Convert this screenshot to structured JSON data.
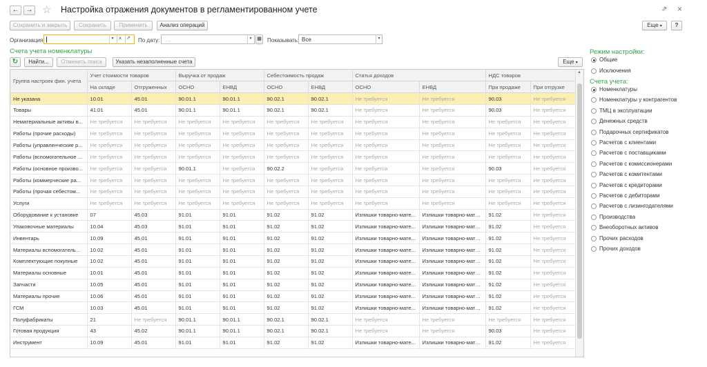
{
  "window": {
    "title": "Настройка отражения документов в регламентированном учете",
    "back_glyph": "←",
    "forward_glyph": "→",
    "star_glyph": "☆",
    "link_glyph": "⇗",
    "close_glyph": "×"
  },
  "toolbar": {
    "save_close": "Сохранить и закрыть",
    "save": "Сохранить",
    "apply": "Применить",
    "analysis": "Анализ операций",
    "more": "Еще",
    "help": "?"
  },
  "filters": {
    "org_label": "Организация:",
    "org_value": "",
    "date_label": "По дату:",
    "date_value": ". .",
    "show_label": "Показывать:",
    "show_value": "Все"
  },
  "section": {
    "title": "Счета учета номенклатуры",
    "find": "Найти...",
    "cancel_search": "Отменить поиск",
    "show_unfilled": "Указать незаполненные счета",
    "more": "Еще"
  },
  "table": {
    "group_header": "Группа настроек фин. учета",
    "group_headers": [
      "Учет стоимости товаров",
      "Выручка от продаж",
      "Себестоимость продаж",
      "Статья доходов",
      "НДС товаров"
    ],
    "sub_headers": [
      "На складе",
      "Отгруженных",
      "ОСНО",
      "ЕНВД",
      "ОСНО",
      "ЕНВД",
      "ОСНО",
      "ЕНВД",
      "При продаже",
      "При отгрузке"
    ],
    "rows": [
      [
        "Не указана",
        "10.01",
        "45.01",
        "90.01.1",
        "90.01.1",
        "90.02.1",
        "90.02.1",
        "Не требуется",
        "Не требуется",
        "90.03",
        "Не требуется"
      ],
      [
        "Товары",
        "41.01",
        "45.01",
        "90.01.1",
        "90.01.1",
        "90.02.1",
        "90.02.1",
        "Не требуется",
        "Не требуется",
        "90.03",
        "Не требуется"
      ],
      [
        "Нематериальные активы в...",
        "Не требуется",
        "Не требуется",
        "Не требуется",
        "Не требуется",
        "Не требуется",
        "Не требуется",
        "Не требуется",
        "Не требуется",
        "Не требуется",
        "Не требуется"
      ],
      [
        "Работы (прочие расходы)",
        "Не требуется",
        "Не требуется",
        "Не требуется",
        "Не требуется",
        "Не требуется",
        "Не требуется",
        "Не требуется",
        "Не требуется",
        "Не требуется",
        "Не требуется"
      ],
      [
        "Работы (управленческие р...",
        "Не требуется",
        "Не требуется",
        "Не требуется",
        "Не требуется",
        "Не требуется",
        "Не требуется",
        "Не требуется",
        "Не требуется",
        "Не требуется",
        "Не требуется"
      ],
      [
        "Работы (вспомогательное ...",
        "Не требуется",
        "Не требуется",
        "Не требуется",
        "Не требуется",
        "Не требуется",
        "Не требуется",
        "Не требуется",
        "Не требуется",
        "Не требуется",
        "Не требуется"
      ],
      [
        "Работы (основное произво...",
        "Не требуется",
        "Не требуется",
        "90.01.1",
        "Не требуется",
        "90.02.2",
        "Не требуется",
        "Не требуется",
        "Не требуется",
        "90.03",
        "Не требуется"
      ],
      [
        "Работы (коммерческие ра...",
        "Не требуется",
        "Не требуется",
        "Не требуется",
        "Не требуется",
        "Не требуется",
        "Не требуется",
        "Не требуется",
        "Не требуется",
        "Не требуется",
        "Не требуется"
      ],
      [
        "Работы (прочая себестом...",
        "Не требуется",
        "Не требуется",
        "Не требуется",
        "Не требуется",
        "Не требуется",
        "Не требуется",
        "Не требуется",
        "Не требуется",
        "Не требуется",
        "Не требуется"
      ],
      [
        "Услуги",
        "Не требуется",
        "Не требуется",
        "Не требуется",
        "Не требуется",
        "Не требуется",
        "Не требуется",
        "Не требуется",
        "Не требуется",
        "Не требуется",
        "Не требуется"
      ],
      [
        "Оборудование к установке",
        "07",
        "45.03",
        "91.01",
        "91.01",
        "91.02",
        "91.02",
        "Излишки товарно-мате...",
        "Излишки товарно-мате...",
        "91.02",
        "Не требуется"
      ],
      [
        "Упаковочные материалы",
        "10.04",
        "45.03",
        "91.01",
        "91.01",
        "91.02",
        "91.02",
        "Излишки товарно-мате...",
        "Излишки товарно-мате...",
        "91.02",
        "Не требуется"
      ],
      [
        "Инвентарь",
        "10.09",
        "45.01",
        "91.01",
        "91.01",
        "91.02",
        "91.02",
        "Излишки товарно-мате...",
        "Излишки товарно-мате...",
        "91.02",
        "Не требуется"
      ],
      [
        "Материалы вспомогатель...",
        "10.02",
        "45.01",
        "91.01",
        "91.01",
        "91.02",
        "91.02",
        "Излишки товарно-мате...",
        "Излишки товарно-мате...",
        "91.02",
        "Не требуется"
      ],
      [
        "Комплектующие покупные",
        "10.02",
        "45.01",
        "91.01",
        "91.01",
        "91.02",
        "91.02",
        "Излишки товарно-мате...",
        "Излишки товарно-мате...",
        "91.02",
        "Не требуется"
      ],
      [
        "Материалы основные",
        "10.01",
        "45.01",
        "91.01",
        "91.01",
        "91.02",
        "91.02",
        "Излишки товарно-мате...",
        "Излишки товарно-мате...",
        "91.02",
        "Не требуется"
      ],
      [
        "Запчасти",
        "10.05",
        "45.01",
        "91.01",
        "91.01",
        "91.02",
        "91.02",
        "Излишки товарно-мате...",
        "Излишки товарно-мате...",
        "91.02",
        "Не требуется"
      ],
      [
        "Материалы прочие",
        "10.06",
        "45.01",
        "91.01",
        "91.01",
        "91.02",
        "91.02",
        "Излишки товарно-мате...",
        "Излишки товарно-мате...",
        "91.02",
        "Не требуется"
      ],
      [
        "ГСМ",
        "10.03",
        "45.01",
        "91.01",
        "91.01",
        "91.02",
        "91.02",
        "Излишки товарно-мате...",
        "Излишки товарно-мате...",
        "91.02",
        "Не требуется"
      ],
      [
        "Полуфабрикаты",
        "21",
        "Не требуется",
        "90.01.1",
        "90.01.1",
        "90.02.1",
        "90.02.1",
        "Не требуется",
        "Не требуется",
        "Не требуется",
        "Не требуется"
      ],
      [
        "Готовая продукция",
        "43",
        "45.02",
        "90.01.1",
        "90.01.1",
        "90.02.1",
        "90.02.1",
        "Не требуется",
        "Не требуется",
        "90.03",
        "Не требуется"
      ],
      [
        "Инструмент",
        "10.09",
        "45.01",
        "91.01",
        "91.01",
        "91.02",
        "91.02",
        "Излишки товарно-мате...",
        "Излишки товарно-мате...",
        "91.02",
        "Не требуется"
      ]
    ]
  },
  "settings_mode": {
    "title": "Режим настройки:",
    "options": [
      "Общие",
      "Исключения"
    ],
    "selected_index": 0
  },
  "accounts": {
    "title": "Счета учета:",
    "options": [
      "Номенклатуры",
      "Номенклатуры у контрагентов",
      "ТМЦ в эксплуатации",
      "Денежных средств",
      "Подарочных сертификатов",
      "Расчетов с клиентами",
      "Расчетов с поставщиками",
      "Расчетов с комиссионерами",
      "Расчетов с комитентами",
      "Расчетов с кредиторами",
      "Расчетов с дебиторами",
      "Расчетов с лизингодателями",
      "Производства",
      "Внеоборотных активов",
      "Прочих расходов",
      "Прочих доходов"
    ],
    "selected_index": 0
  },
  "colors": {
    "accent_green": "#37a349",
    "selected_row": "#fbefb4",
    "field_focus": "#f2b200"
  }
}
